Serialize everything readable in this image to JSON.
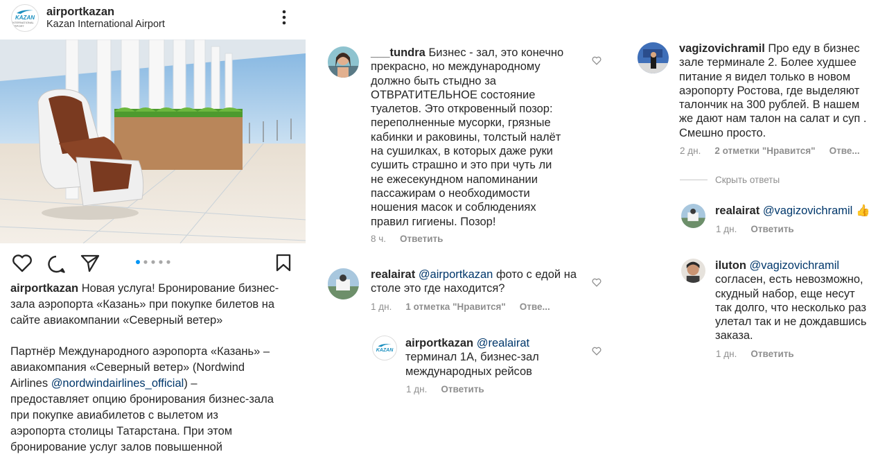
{
  "post": {
    "username": "airportkazan",
    "subtitle": "Kazan International Airport",
    "logo_text": "KAZAN",
    "logo_sub": "INTERNATIONAL AIRPORT",
    "caption_username": "airportkazan",
    "caption_line1": "Новая услуга! Бронирование бизнес-",
    "caption_line2": "зала аэропорта «Казань» при покупке билетов на",
    "caption_line3": "сайте авиакомпании «Северный ветер»",
    "para_line1": "Партнёр Международного аэропорта «Казань» –",
    "para_line2": "авиакомпания «Северный ветер» (Nordwind",
    "para_line3_pre": "Airlines ",
    "para_line3_mention": "@nordwindairlines_official",
    "para_line3_post": ") –",
    "para_line4": "предоставляет опцию бронирования бизнес-зала",
    "para_line5": "при покупке авиабилетов с вылетом из",
    "para_line6": "аэропорта столицы Татарстана. При этом",
    "para_line7": "бронирование услуг залов повышенной"
  },
  "comments_mid": [
    {
      "username": "___tundra",
      "lines": [
        "Бизнес - зал, это конечно",
        "прекрасно, но международному",
        "должно быть стыдно за",
        "ОТВРАТИТЕЛЬНОЕ состояние",
        "туалетов. Это откровенный позор:",
        "переполненные мусорки, грязные",
        "кабинки и раковины, толстый налёт",
        "на сушилках, в которых даже руки",
        "сушить страшно и это при чуть ли",
        "не ежесекундном напоминании",
        "пассажирам о необходимости",
        "ношения масок и соблюдениях",
        "правил гигиены. Позор!"
      ],
      "time": "8 ч.",
      "reply": "Ответить"
    },
    {
      "username": "realairat",
      "mention": "@airportkazan",
      "line1_post": " фото с едой на",
      "line2": "столе это где находится?",
      "time": "1 дн.",
      "likes": "1 отметка \"Нравится\"",
      "reply": "Отве..."
    },
    {
      "username": "airportkazan",
      "mention": "@realairat",
      "line2": "терминал 1А, бизнес-зал",
      "line3": "международных рейсов",
      "time": "1 дн.",
      "reply": "Ответить"
    }
  ],
  "comments_right": [
    {
      "username": "vagizovichramil",
      "line1_post": " Про еду в  бизнес",
      "lines": [
        "зале терминале 2. Более худшее",
        "питание я видел только в новом",
        "аэропорту Ростова, где выделяют",
        "талончик на 300 рублей. В нашем",
        "же дают нам талон на салат и суп .",
        "Смешно просто."
      ],
      "time": "2 дн.",
      "likes": "2 отметки \"Нравится\"",
      "reply": "Отве..."
    },
    {
      "hide_replies": "Скрыть ответы"
    },
    {
      "username": "realairat",
      "mention": "@vagizovichramil",
      "emoji": "👍",
      "time": "1 дн.",
      "reply": "Ответить"
    },
    {
      "username": "iluton",
      "mention": "@vagizovichramil",
      "lines": [
        "согласен, есть невозможно,",
        "скудный набор, еще несут",
        "так долго, что несколько раз",
        "улетал так и не дождавшись",
        "заказа."
      ],
      "time": "1 дн.",
      "reply": "Ответить"
    }
  ],
  "colors": {
    "text": "#262626",
    "muted": "#8e8e8e",
    "mention": "#00376b",
    "dot_active": "#0095f6",
    "dot_inactive": "#a8a8a8"
  },
  "icons": [
    "heart-icon",
    "comment-icon",
    "share-icon",
    "bookmark-icon",
    "more-icon",
    "carousel-dots"
  ]
}
